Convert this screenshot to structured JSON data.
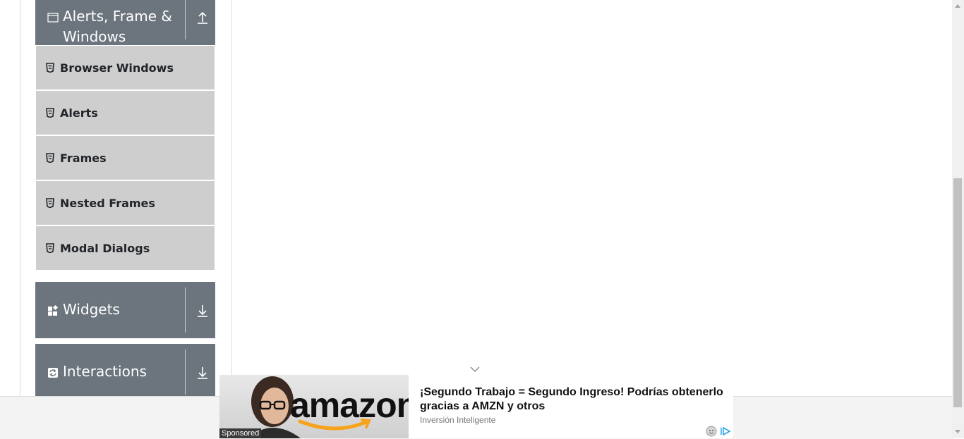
{
  "sidebar": {
    "groups": [
      {
        "title": "Alerts, Frame &\nWindows",
        "icon": "window-icon",
        "state": "expanded"
      },
      {
        "title": "Widgets",
        "icon": "widgets-icon",
        "state": "collapsed"
      },
      {
        "title": "Interactions",
        "icon": "interactions-icon",
        "state": "collapsed"
      }
    ],
    "items": [
      {
        "label": "Browser Windows",
        "icon": "html5-icon"
      },
      {
        "label": "Alerts",
        "icon": "html5-icon"
      },
      {
        "label": "Frames",
        "icon": "html5-icon"
      },
      {
        "label": "Nested Frames",
        "icon": "html5-icon"
      },
      {
        "label": "Modal Dialogs",
        "icon": "html5-icon"
      }
    ]
  },
  "ad": {
    "headline": "¡Segundo Trabajo = Segundo Ingreso! Podrías obtenerlo gracias a AMZN y otros",
    "source": "Inversión Inteligente",
    "sponsored_label": "Sponsored",
    "image_logo_text": "amazon"
  },
  "colors": {
    "group_header_bg": "#6c757d",
    "menu_item_bg": "#cecece",
    "footer_bg": "#f3f3f3"
  }
}
